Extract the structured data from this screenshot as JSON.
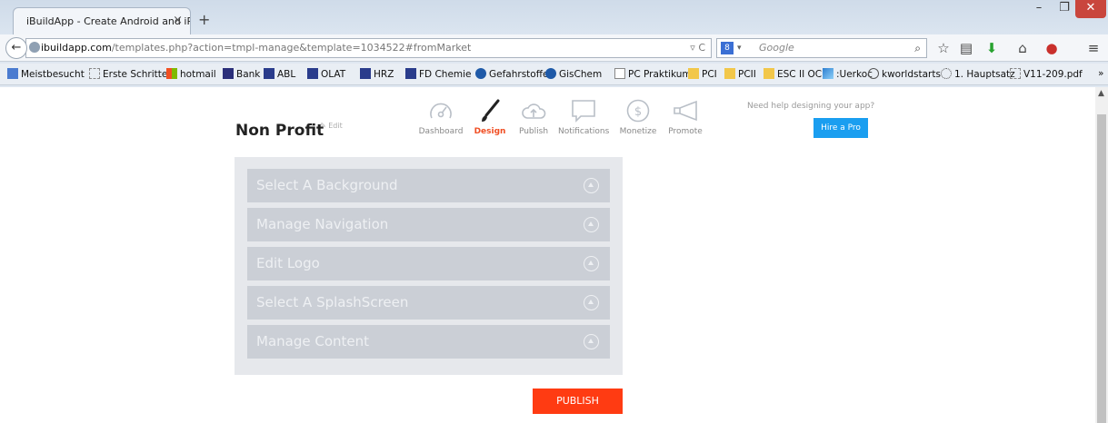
{
  "browser": {
    "tab_title": "iBuildApp - Create Android and iP...",
    "tab_close": "×",
    "new_tab": "+",
    "window": {
      "minimize": "–",
      "maximize": "❐",
      "close": "✕"
    },
    "url_host": "ibuildapp.com",
    "url_path": "/templates.php?action=tmpl-manage&template=1034522#fromMarket",
    "url_actions": "▿ C",
    "search_placeholder": "Google",
    "search_engine_icon": "8",
    "bookmarks": [
      "Meistbesucht",
      "Erste Schritte",
      "hotmail",
      "Bank",
      "ABL",
      "OLAT",
      "HRZ",
      "FD Chemie",
      "Gefahrstoffe",
      "GisChem",
      "PC Praktikum",
      "PCI",
      "PCII",
      "ESC II OC",
      ":Uerkoc",
      "kworldstarts",
      "1. Hauptsatz",
      "V11-209.pdf"
    ],
    "bookmarks_more": "»"
  },
  "app": {
    "title": "Non Profit",
    "edit_label": "✎ Edit",
    "nav": [
      {
        "label": "Dashboard",
        "icon": "dashboard-icon"
      },
      {
        "label": "Design",
        "icon": "brush-icon",
        "active": true
      },
      {
        "label": "Publish",
        "icon": "cloud-upload-icon"
      },
      {
        "label": "Notifications",
        "icon": "chat-bubble-icon"
      },
      {
        "label": "Monetize",
        "icon": "dollar-icon"
      },
      {
        "label": "Promote",
        "icon": "megaphone-icon"
      }
    ],
    "help_text": "Need help designing your app?",
    "hire_label": "Hire a Pro",
    "design_rows": [
      "Select A Background",
      "Manage Navigation",
      "Edit Logo",
      "Select A SplashScreen",
      "Manage Content"
    ],
    "publish_label": "PUBLISH"
  },
  "colors": {
    "accent": "#f04e23",
    "hire": "#1a9ef0",
    "publish": "#ff3b12"
  }
}
